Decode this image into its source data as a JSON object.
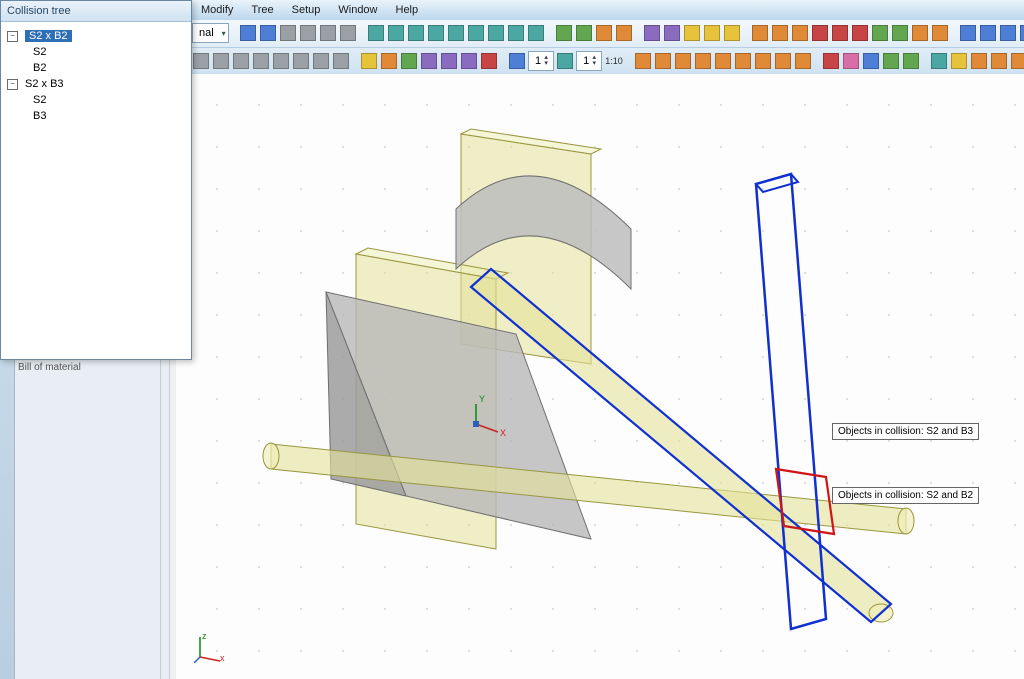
{
  "menu": {
    "items": [
      "Modify",
      "Tree",
      "Setup",
      "Window",
      "Help"
    ]
  },
  "style_dropdown": "nal",
  "spinner1": "1",
  "spinner2": "1",
  "scale_label": "1:10",
  "collision_tree": {
    "title": "Collision tree",
    "nodes": [
      {
        "label": "S2 x B2",
        "children": [
          "S2",
          "B2"
        ],
        "selected": true
      },
      {
        "label": "S2 x B3",
        "children": [
          "S2",
          "B3"
        ],
        "selected": false
      }
    ]
  },
  "left_dock": {
    "bom_label": "Bill of material"
  },
  "annotations": {
    "a1": "Objects in collision: S2 and B3",
    "a2": "Objects in collision: S2 and B2"
  },
  "axis": {
    "z": "z",
    "x": "x"
  },
  "origin_labels": {
    "y": "Y",
    "x": "X"
  }
}
